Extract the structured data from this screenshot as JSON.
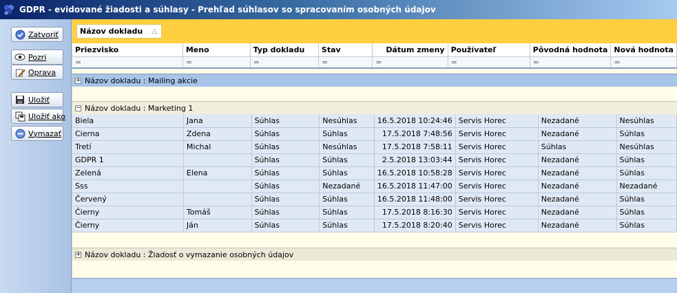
{
  "window": {
    "title": "GDPR - evidované žiadosti a súhlasy - Prehľad súhlasov so spracovaním osobných údajov"
  },
  "sidebar": {
    "buttons": [
      {
        "label": "Zatvoriť",
        "icon": "check-icon"
      },
      {
        "label": "Pozri",
        "icon": "eye-icon"
      },
      {
        "label": "Oprava",
        "icon": "edit-icon"
      },
      {
        "label": "Uložiť",
        "icon": "save-icon"
      },
      {
        "label": "Uložiť ako",
        "icon": "save-as-icon"
      },
      {
        "label": "Vymazať",
        "icon": "delete-icon"
      }
    ]
  },
  "grid": {
    "group_by": "Názov dokladu",
    "filter_symbol": "=",
    "columns": [
      "Priezvisko",
      "Meno",
      "Typ dokladu",
      "Stav",
      "Dátum zmeny",
      "Používateľ",
      "Pôvodná hodnota",
      "Nová hodnota"
    ],
    "groups": [
      {
        "label": "Názov dokladu : Mailing akcie",
        "expand": "+"
      },
      {
        "label": "Názov dokladu : Marketing 1",
        "expand": "−"
      },
      {
        "label": "Názov dokladu : Žiadosť o vymazanie osobných údajov",
        "expand": "+"
      }
    ],
    "rows": [
      [
        "Biela",
        "Jana",
        "Súhlas",
        "Nesúhlas",
        "16.5.2018 10:24:46",
        "Servis Horec",
        "Nezadané",
        "Nesúhlas"
      ],
      [
        "Cierna",
        "Zdena",
        "Súhlas",
        "Súhlas",
        "17.5.2018 7:48:56",
        "Servis Horec",
        "Nezadané",
        "Súhlas"
      ],
      [
        "Tretí",
        "Michal",
        "Súhlas",
        "Nesúhlas",
        "17.5.2018 7:58:11",
        "Servis Horec",
        "Súhlas",
        "Nesúhlas"
      ],
      [
        "GDPR 1",
        "",
        "Súhlas",
        "Súhlas",
        "2.5.2018 13:03:44",
        "Servis Horec",
        "Nezadané",
        "Súhlas"
      ],
      [
        "Zelená",
        "Elena",
        "Súhlas",
        "Súhlas",
        "16.5.2018 10:58:28",
        "Servis Horec",
        "Nezadané",
        "Súhlas"
      ],
      [
        "Sss",
        "",
        "Súhlas",
        "Nezadané",
        "16.5.2018 11:47:00",
        "Servis Horec",
        "Nezadané",
        "Nezadané"
      ],
      [
        "Červený",
        "",
        "Súhlas",
        "Súhlas",
        "16.5.2018 11:48:00",
        "Servis Horec",
        "Nezadané",
        "Súhlas"
      ],
      [
        "Čierny",
        "Tomáš",
        "Súhlas",
        "Súhlas",
        "17.5.2018 8:16:30",
        "Servis Horec",
        "Nezadané",
        "Súhlas"
      ],
      [
        "Čierny",
        "Ján",
        "Súhlas",
        "Súhlas",
        "17.5.2018 8:20:40",
        "Servis Horec",
        "Nezadané",
        "Súhlas"
      ]
    ]
  }
}
